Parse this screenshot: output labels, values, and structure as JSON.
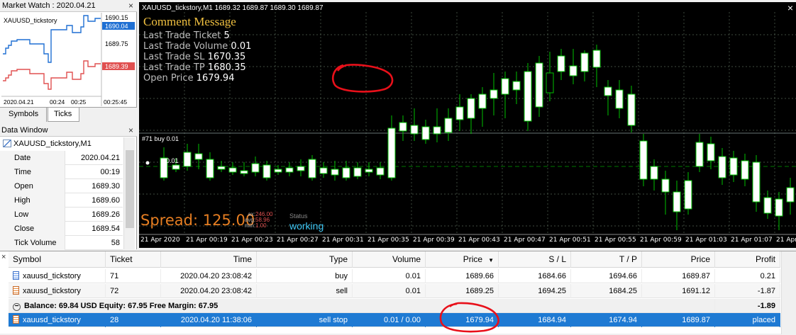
{
  "market_watch": {
    "title": "Market Watch : 2020.04.21",
    "symbol": "XAUUSD_tickstory",
    "price_levels": [
      "1690.15",
      "1690.04",
      "1689.75",
      "1689.39"
    ],
    "time_labels": [
      "2020.04.21",
      "00:24",
      "00:25",
      "00:25:45"
    ],
    "tabs": [
      "Symbols",
      "Ticks"
    ],
    "active_tab": "Ticks",
    "colors": {
      "ask": "#1e6fd3",
      "bid": "#e05050"
    }
  },
  "data_window": {
    "title": "Data Window",
    "symbol": "XAUUSD_tickstory,M1",
    "rows": [
      {
        "key": "Date",
        "value": "2020.04.21"
      },
      {
        "key": "Time",
        "value": "00:19"
      },
      {
        "key": "Open",
        "value": "1689.30"
      },
      {
        "key": "High",
        "value": "1689.60"
      },
      {
        "key": "Low",
        "value": "1689.26"
      },
      {
        "key": "Close",
        "value": "1689.54"
      },
      {
        "key": "Tick Volume",
        "value": "58"
      }
    ]
  },
  "chart": {
    "title": "XAUUSD_tickstory,M1  1689.32 1689.87 1689.30 1689.87",
    "comment_title": "Comment Message",
    "comment_lines": [
      {
        "label": "Last Trade Ticket ",
        "value": "5"
      },
      {
        "label": "Last Trade Volume ",
        "value": "0.01"
      },
      {
        "label": "Last Trade SL ",
        "value": "1670.35"
      },
      {
        "label": "Last Trade TP ",
        "value": "1680.35"
      },
      {
        "label": "Open Price ",
        "value": "1679.94"
      }
    ],
    "spread_text": "Spread: 125.00",
    "stats": [
      "246.00",
      "58.96",
      "1.00"
    ],
    "stats_labels": [
      "ax:",
      "avg:",
      "min:"
    ],
    "status_label": "Status",
    "status_value": "working",
    "buy_line_label": "#71 buy 0.01",
    "buy_line_label2": "0.01",
    "x_labels": [
      "21 Apr 2020",
      "21 Apr 00:19",
      "21 Apr 00:23",
      "21 Apr 00:27",
      "21 Apr 00:31",
      "21 Apr 00:35",
      "21 Apr 00:39",
      "21 Apr 00:43",
      "21 Apr 00:47",
      "21 Apr 00:51",
      "21 Apr 00:55",
      "21 Apr 00:59",
      "21 Apr 01:03",
      "21 Apr 01:07",
      "21 Apr 01:11"
    ],
    "colors": {
      "background": "#000000",
      "candle": "#00c000",
      "grid": "#556655",
      "comment_title": "#f0c040",
      "spread": "#e67e22",
      "status": "#3fc7f5"
    }
  },
  "terminal": {
    "headers": [
      "Symbol",
      "Ticket",
      "Time",
      "Type",
      "Volume",
      "Price",
      "S / L",
      "T / P",
      "Price",
      "Profit"
    ],
    "sort_indicator": "▼",
    "rows": [
      {
        "symbol": "xauusd_tickstory",
        "ticket": "71",
        "time": "2020.04.20 23:08:42",
        "type": "buy",
        "volume": "0.01",
        "price": "1689.66",
        "sl": "1684.66",
        "tp": "1694.66",
        "cur_price": "1689.87",
        "profit": "0.21"
      },
      {
        "symbol": "xauusd_tickstory",
        "ticket": "72",
        "time": "2020.04.20 23:08:42",
        "type": "sell",
        "volume": "0.01",
        "price": "1689.25",
        "sl": "1694.25",
        "tp": "1684.25",
        "cur_price": "1691.12",
        "profit": "-1.87"
      }
    ],
    "balance_text": "Balance: 69.84 USD  Equity: 67.95  Free Margin: 67.95",
    "balance_profit": "-1.89",
    "order": {
      "symbol": "xauusd_tickstory",
      "ticket": "28",
      "time": "2020.04.20 11:38:06",
      "type": "sell stop",
      "volume": "0.01 / 0.00",
      "price": "1679.94",
      "sl": "1684.94",
      "tp": "1674.94",
      "cur_price": "1689.87",
      "profit": "placed"
    }
  }
}
